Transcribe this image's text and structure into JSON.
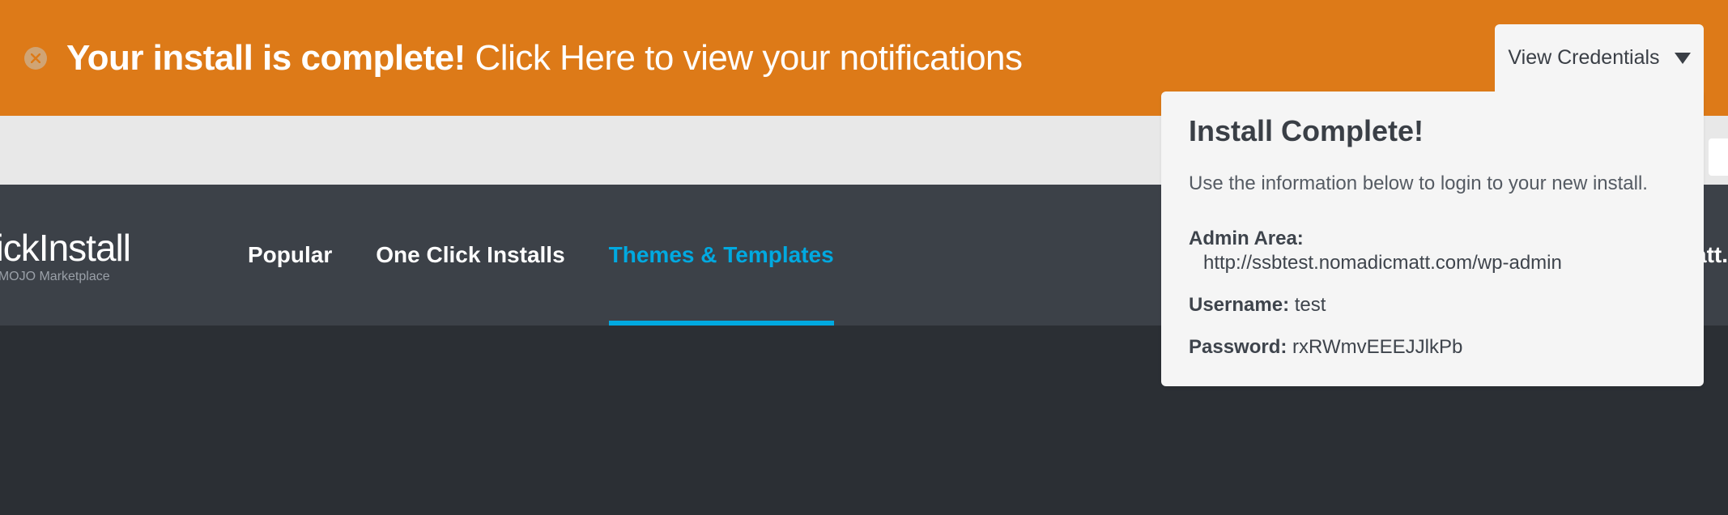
{
  "banner": {
    "bold_text": "Your install is complete!",
    "rest_text": " Click Here to view your notifications"
  },
  "credentials_tab": {
    "label": "View Credentials"
  },
  "credentials_panel": {
    "title": "Install Complete!",
    "instruction": "Use the information below to login to your new install.",
    "admin_label": "Admin Area:",
    "admin_url": "http://ssbtest.nomadicmatt.com/wp-admin",
    "username_label": "Username:",
    "username_value": "test",
    "password_label": "Password:",
    "password_value": "rxRWmvEEEJJlkPb"
  },
  "brand": {
    "name": "uickInstall",
    "subtitle": "ered by MOJO Marketplace"
  },
  "nav": {
    "items": [
      {
        "label": "Popular"
      },
      {
        "label": "One Click Installs"
      },
      {
        "label": "Themes & Templates"
      }
    ],
    "right_fragment": "natt."
  }
}
